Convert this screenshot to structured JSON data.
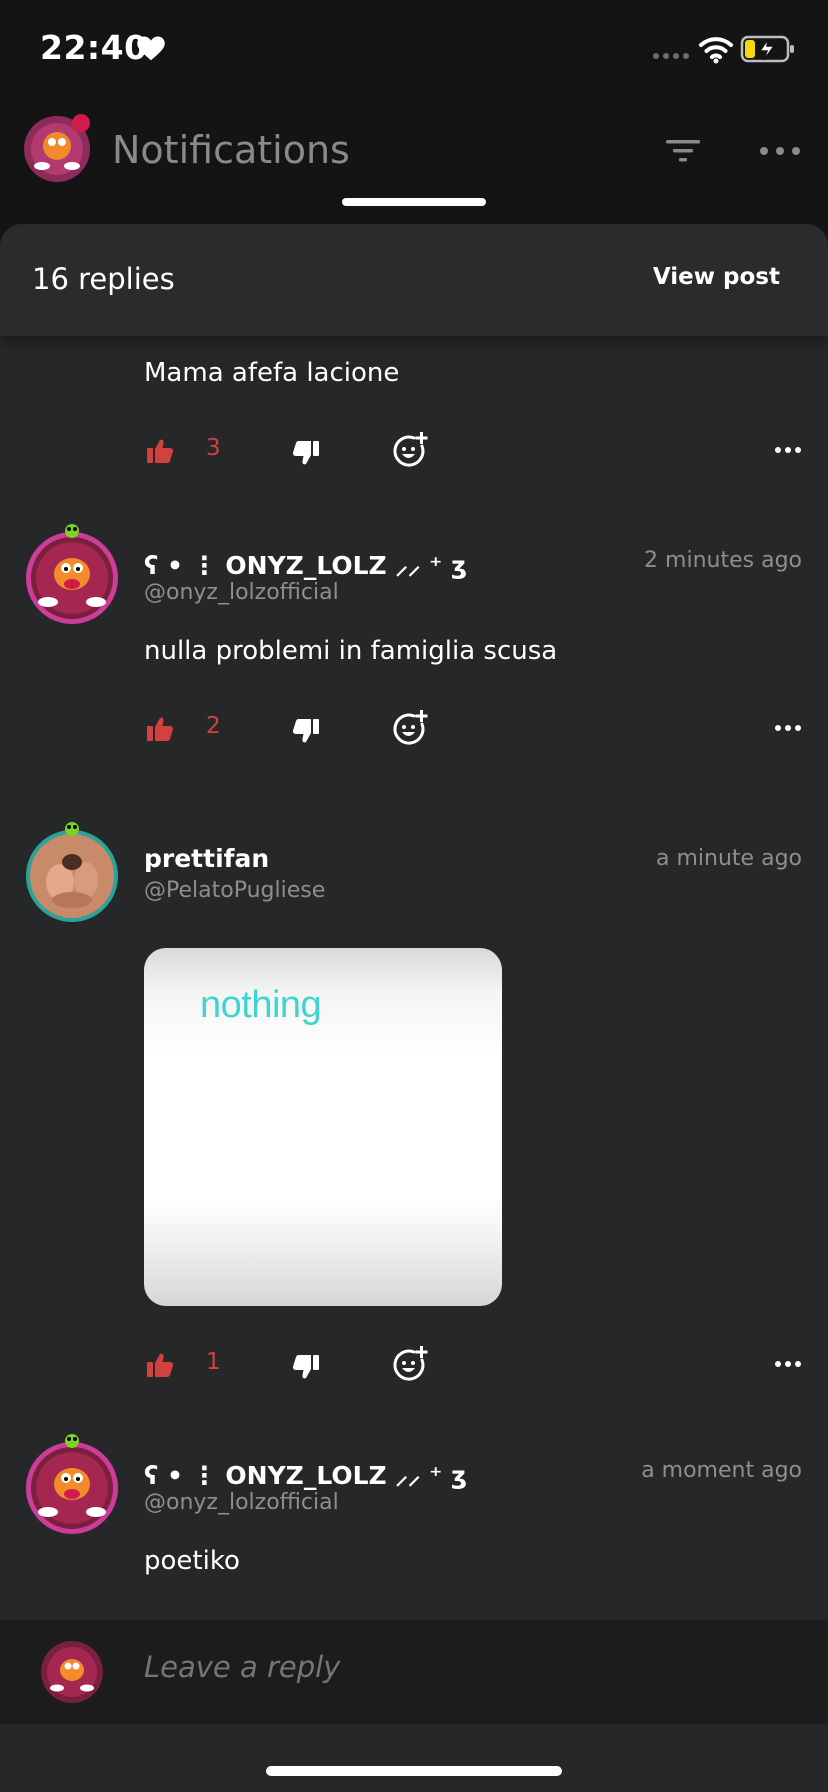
{
  "status_bar": {
    "time": "22:40",
    "icons": [
      "heart-icon",
      "signal-icon",
      "wifi-icon",
      "battery-charging-icon"
    ]
  },
  "header": {
    "title": "Notifications",
    "icons": [
      "filter-icon",
      "more-icon"
    ]
  },
  "sheet": {
    "replies_count": "16 replies",
    "view_post_label": "View post"
  },
  "comments": [
    {
      "text": "Mama afefa lacione",
      "likes": "3"
    },
    {
      "username": "ʕ • ⋮ ONYZ_LOLZ ⸝⸝ ⁺ ʒ",
      "handle": "@onyz_lolzofficial",
      "timestamp": "2 minutes ago",
      "text": "nulla problemi in famiglia scusa",
      "likes": "2"
    },
    {
      "username": "prettifan",
      "handle": "@PelatoPugliese",
      "timestamp": "a minute ago",
      "image_text": "nothing",
      "likes": "1"
    },
    {
      "username": "ʕ • ⋮ ONYZ_LOLZ ⸝⸝ ⁺ ʒ",
      "handle": "@onyz_lolzofficial",
      "timestamp": "a moment ago",
      "text": "poetiko"
    }
  ],
  "reply_bar": {
    "placeholder": "Leave a reply"
  },
  "colors": {
    "background": "#141414",
    "sheet": "#262728",
    "like_red": "#d3413f",
    "muted_text": "#8e8e8e"
  }
}
